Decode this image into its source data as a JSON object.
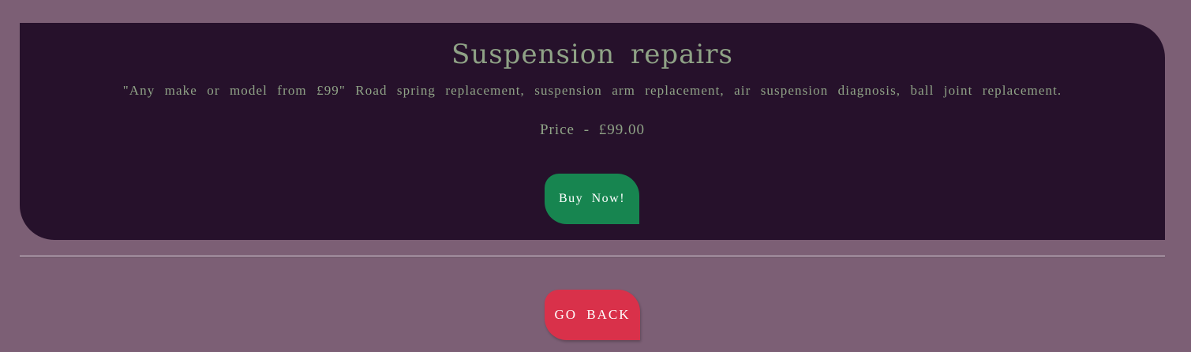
{
  "product": {
    "title": "Suspension repairs",
    "description": "\"Any make or model from £99\" Road spring replacement, suspension arm replacement, air suspension diagnosis, ball joint replacement.",
    "price_label": "Price - £99.00",
    "buy_label": "Buy Now!"
  },
  "nav": {
    "back_label": "GO BACK"
  },
  "colors": {
    "page_background": "#7c5f75",
    "card_background": "#26112b",
    "text": "#8fa286",
    "buy_button": "#178550",
    "back_button": "#d9314a"
  }
}
